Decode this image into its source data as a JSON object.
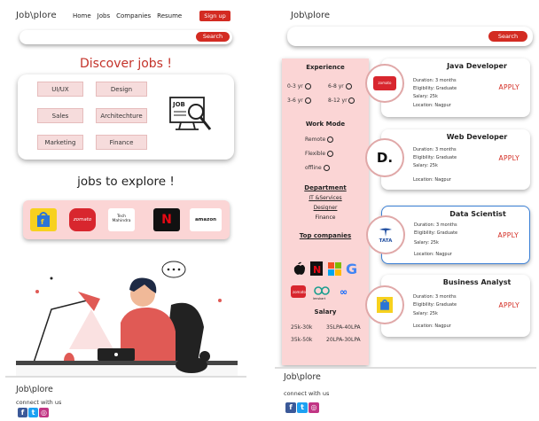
{
  "left": {
    "logo": "Job\\plore",
    "nav": [
      "Home",
      "Jobs",
      "Companies",
      "Resume"
    ],
    "signup": "Sign up",
    "search_button": "Search",
    "discover_title": "Discover jobs !",
    "categories": [
      "UI/UX",
      "Design",
      "Sales",
      "Architechture",
      "Marketing",
      "Finance"
    ],
    "job_icon_text": "JOB",
    "explore_title": "jobs to explore !",
    "companies": [
      "flipkart",
      "zomato",
      "Tech Mahindra",
      "Netflix",
      "amazon"
    ],
    "company_labels": {
      "zomato": "zomato",
      "tech": "Tech Mahindra",
      "netflix": "N",
      "amazon": "amazon"
    },
    "footer_logo": "Job\\plore",
    "footer_connect": "connect with us"
  },
  "right": {
    "logo": "Job\\plore",
    "search_button": "Search",
    "filters": {
      "experience_title": "Experience",
      "experience_options": [
        "0-3 yr",
        "6-8 yr",
        "3-6 yr",
        "8-12 yr"
      ],
      "workmode_title": "Work Mode",
      "workmode_options": [
        "Remote",
        "Flexible",
        "offline"
      ],
      "department_title": "Department",
      "departments": [
        "IT &Services",
        "Designer",
        "Finance"
      ],
      "top_companies_title": "Top companies",
      "salary_title": "Salary",
      "salary_options": [
        "25k-30k",
        "35LPA-40LPA",
        "35k-50k",
        "20LPA-30LPA"
      ]
    },
    "jobs": [
      {
        "title": "Java Developer",
        "duration": "Duration: 3 months",
        "eligibility": "Eligibility: Graduate",
        "salary": "Salary: 25k",
        "location": "Location: Nagpur",
        "apply": "APPLY",
        "logo": "zomato"
      },
      {
        "title": "Web Developer",
        "duration": "Duration: 3 months",
        "eligibility": "Eligibility: Graduate",
        "salary": "Salary: 25k",
        "location": "Location: Nagpur",
        "apply": "APPLY",
        "logo": "D."
      },
      {
        "title": "Data Scientist",
        "duration": "Duration: 3 months",
        "eligibility": "Eligibility: Graduate",
        "salary": "Salary: 25k",
        "location": "Location: Nagpur",
        "apply": "APPLY",
        "logo": "TATA"
      },
      {
        "title": "Business Analyst",
        "duration": "Duration: 3 months",
        "eligibility": "Eligibility: Graduate",
        "salary": "Salary: 25k",
        "location": "Location: Nagpur",
        "apply": "APPLY",
        "logo": "flipkart"
      }
    ],
    "footer_logo": "Job\\plore",
    "footer_connect": "connect with us"
  },
  "colors": {
    "accent": "#d32b22",
    "pink": "#fbd5d5",
    "selected_border": "#3a7fd5"
  },
  "icons": [
    "search-icon",
    "job-search-icon",
    "facebook-icon",
    "twitter-icon",
    "instagram-icon",
    "apple-icon",
    "windows-icon",
    "google-icon",
    "meta-icon",
    "netflix-icon"
  ]
}
